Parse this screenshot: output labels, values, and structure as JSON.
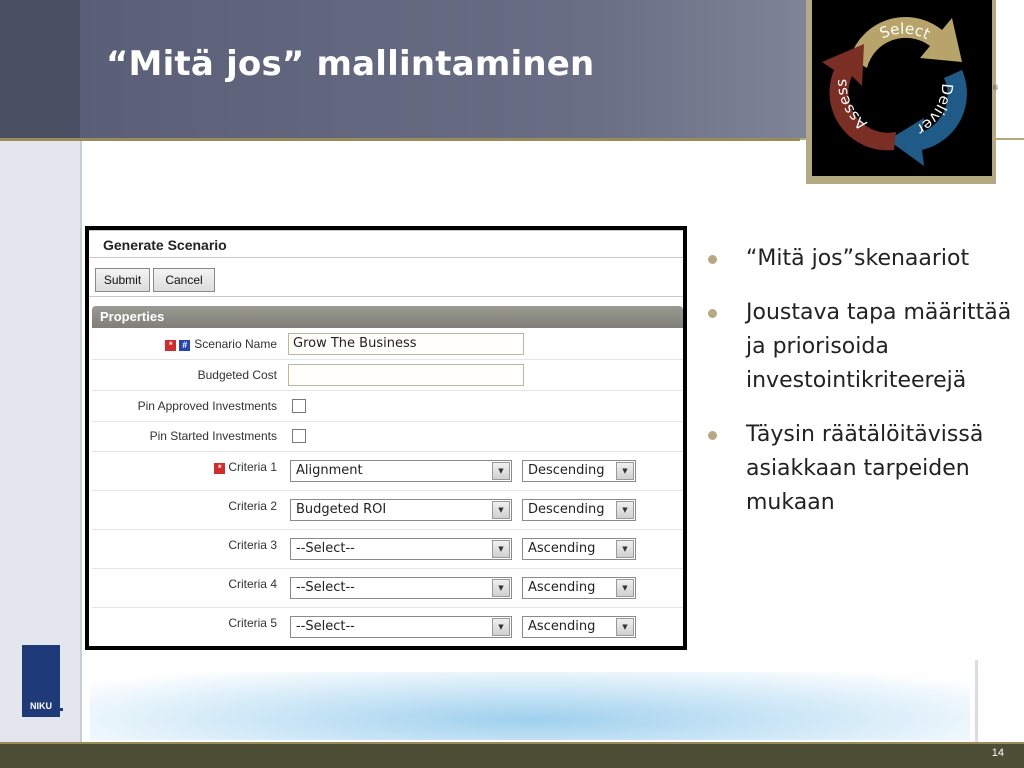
{
  "slide": {
    "title": "“Mitä jos” mallintaminen",
    "page_number": "14"
  },
  "logo": {
    "words": [
      "Select",
      "Deliver",
      "Assess"
    ],
    "colors": {
      "select": "#b8a46a",
      "deliver": "#1f5b86",
      "assess": "#7a2e24"
    }
  },
  "niku": {
    "text": "NIKU"
  },
  "form": {
    "title": "Generate Scenario",
    "buttons": {
      "submit": "Submit",
      "cancel": "Cancel"
    },
    "section_label": "Properties",
    "scenario_name": {
      "label": "Scenario Name",
      "value": "Grow The Business"
    },
    "budgeted_cost": {
      "label": "Budgeted Cost",
      "value": ""
    },
    "pin_approved": {
      "label": "Pin Approved Investments",
      "checked": false
    },
    "pin_started": {
      "label": "Pin Started Investments",
      "checked": false
    },
    "criteria": [
      {
        "label": "Criteria 1",
        "value": "Alignment",
        "order": "Descending",
        "required": true
      },
      {
        "label": "Criteria 2",
        "value": "Budgeted ROI",
        "order": "Descending",
        "required": false
      },
      {
        "label": "Criteria 3",
        "value": "--Select--",
        "order": "Ascending",
        "required": false
      },
      {
        "label": "Criteria 4",
        "value": "--Select--",
        "order": "Ascending",
        "required": false
      },
      {
        "label": "Criteria 5",
        "value": "--Select--",
        "order": "Ascending",
        "required": false
      }
    ]
  },
  "bullets": [
    "“Mitä jos”skenaariot",
    "Joustava tapa määrittää ja priorisoida investointikriteerejä",
    "Täysin räätälöitävissä asiakkaan tarpeiden mukaan"
  ]
}
